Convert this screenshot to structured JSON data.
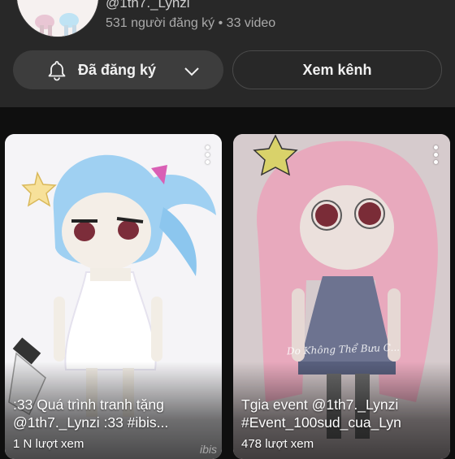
{
  "channel": {
    "handle": "@1th7._Lynzi",
    "meta": "531 người đăng ký • 33 video"
  },
  "buttons": {
    "subscribed_label": "Đã đăng ký",
    "view_channel_label": "Xem kênh"
  },
  "videos": [
    {
      "title_line1": ":33 Quá trình tranh tặng",
      "title_line2": "@1th7._Lynzi  :33     #ibis...",
      "views": "1 N lượt xem",
      "watermark": "ibis"
    },
    {
      "title_line1": "Tgia event @1th7._Lynzi",
      "title_line2": "#Event_100sud_cua_Lyn",
      "views": "478 lượt xem",
      "signature": "Do Không Thể Bưu C..."
    }
  ],
  "colors": {
    "background": "#0f0f0f",
    "header": "#282828",
    "button": "#3d3d3d",
    "text_secondary": "#aaaaaa"
  }
}
